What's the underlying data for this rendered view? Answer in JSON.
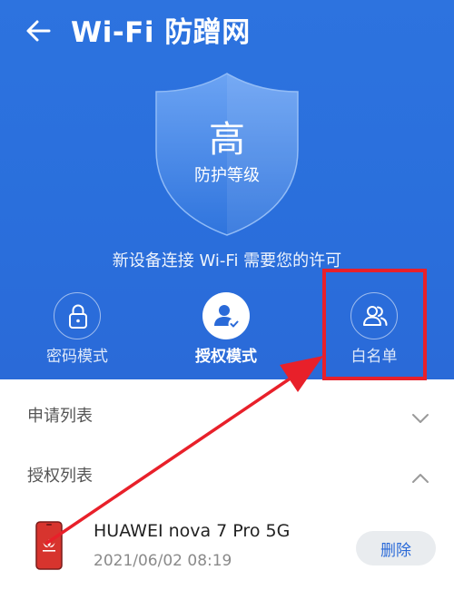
{
  "header": {
    "title": "Wi-Fi 防蹭网",
    "back_icon": "back-arrow-icon",
    "background": "#2a6fdc"
  },
  "protection": {
    "level": "高",
    "level_label": "防护等级",
    "notice": "新设备连接 Wi-Fi 需要您的许可"
  },
  "modes": [
    {
      "label": "密码模式",
      "icon": "lock-icon",
      "selected": false
    },
    {
      "label": "授权模式",
      "icon": "user-check-icon",
      "selected": true
    },
    {
      "label": "白名单",
      "icon": "users-icon",
      "selected": false
    }
  ],
  "sections": {
    "apply_list": {
      "title": "申请列表",
      "expanded": false
    },
    "auth_list": {
      "title": "授权列表",
      "expanded": true
    }
  },
  "devices": [
    {
      "name": "HUAWEI nova 7 Pro 5G",
      "time": "2021/06/02 08:19",
      "action": "删除",
      "icon": "huawei-phone-icon"
    }
  ],
  "annotation": {
    "color": "#e8202a",
    "target": "白名单"
  }
}
